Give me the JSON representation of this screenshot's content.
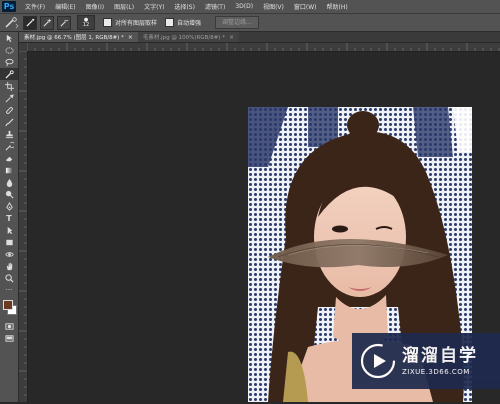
{
  "app": {
    "logo": "Ps"
  },
  "menu": [
    "文件(F)",
    "编辑(E)",
    "图像(I)",
    "图层(L)",
    "文字(Y)",
    "选择(S)",
    "滤镜(T)",
    "3D(D)",
    "视图(V)",
    "窗口(W)",
    "帮助(H)"
  ],
  "options": {
    "brush_size": "12",
    "sample_all_layers": "对所有图层取样",
    "auto_enhance": "自动增强",
    "refine_edge": "调整边缘..."
  },
  "tabs": [
    {
      "label": "素材.jpg @ 66.7% (图层 1, RGB/8#) *",
      "close": "×"
    },
    {
      "label": "毛素材.jpg @ 100%(RGB/8#) *",
      "close": "×"
    }
  ],
  "watermark": {
    "title": "溜溜自学",
    "url": "ZIXUE.3D66.COM"
  },
  "colors": {
    "foreground": "#6b3a22",
    "background": "#ffffff",
    "accent": "#31a8ff"
  }
}
